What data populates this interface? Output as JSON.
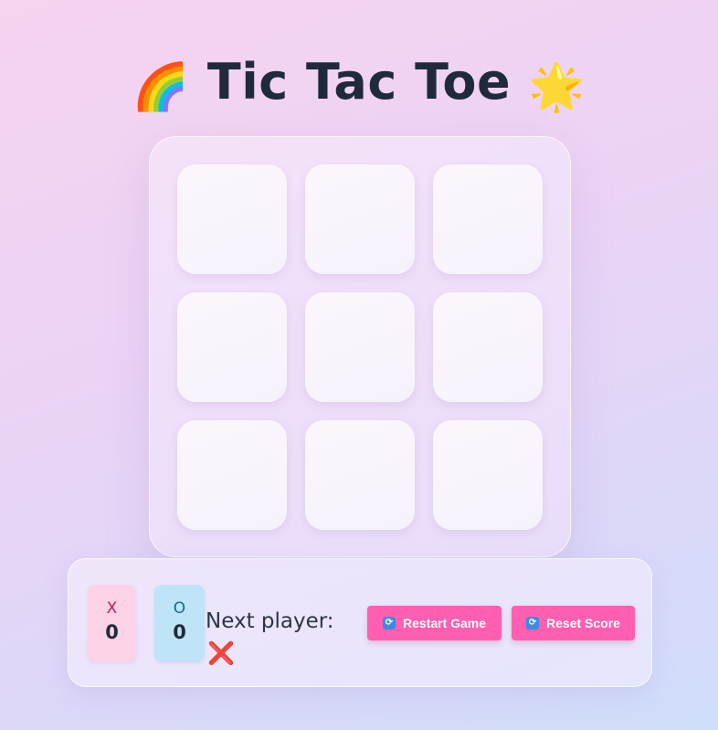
{
  "title": {
    "left_emoji": "🌈",
    "text": "Tic Tac Toe",
    "right_emoji": "🌟"
  },
  "board": {
    "cells": [
      "",
      "",
      "",
      "",
      "",
      "",
      "",
      "",
      ""
    ]
  },
  "scores": {
    "x_label": "X",
    "x_value": "0",
    "o_label": "O",
    "o_value": "0"
  },
  "status": {
    "next_label": "Next player:",
    "next_mark": "❌"
  },
  "buttons": {
    "restart_icon": "🔄",
    "restart_label": "Restart Game",
    "reset_icon": "🔄",
    "reset_label": "Reset Score"
  },
  "colors": {
    "accent": "#ff5fb0",
    "x_badge": "#fbd2e6",
    "o_badge": "#bfe3f7",
    "title_text": "#1f2a3c"
  }
}
